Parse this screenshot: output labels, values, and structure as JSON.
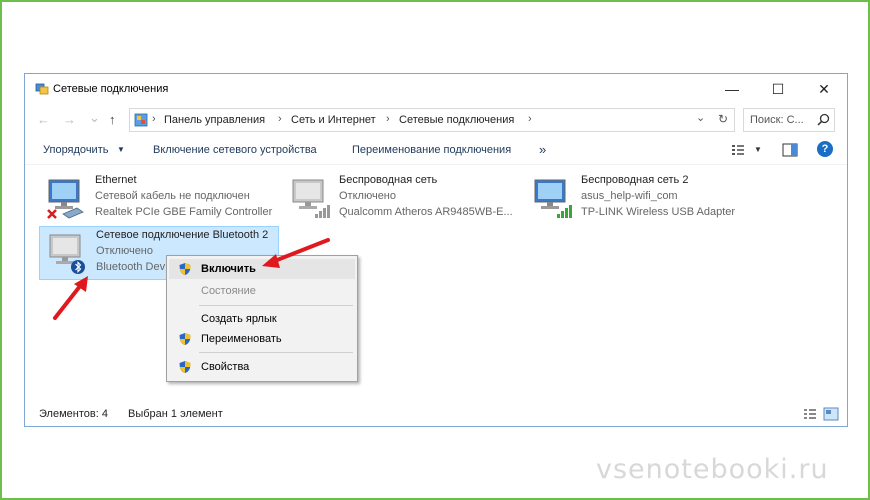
{
  "window": {
    "title": "Сетевые подключения",
    "controls": {
      "minimize": "—",
      "maximize": "☐",
      "close": "✕"
    }
  },
  "nav": {
    "back": "←",
    "forward": "→",
    "recent": "⌄",
    "up": "↑"
  },
  "address": {
    "chevron": "›",
    "crumbs": [
      "Панель управления",
      "Сеть и Интернет",
      "Сетевые подключения"
    ],
    "dropdown": "⌄",
    "refresh": "↻"
  },
  "search": {
    "placeholder": "Поиск: С..."
  },
  "toolbar": {
    "organize": "Упорядочить",
    "organize_arrow": "▼",
    "enable_device": "Включение сетевого устройства",
    "rename": "Переименование подключения",
    "more": "»",
    "view_arrow": "▼",
    "help": "?"
  },
  "connections": [
    {
      "name": "Ethernet",
      "status": "Сетевой кабель не подключен",
      "device": "Realtek PCIe GBE Family Controller"
    },
    {
      "name": "Беспроводная сеть",
      "status": "Отключено",
      "device": "Qualcomm Atheros AR9485WB-E..."
    },
    {
      "name": "Беспроводная сеть 2",
      "status": "asus_help-wifi_com",
      "device": "TP-LINK Wireless USB Adapter"
    },
    {
      "name": "Сетевое подключение Bluetooth 2",
      "status": "Отключено",
      "device": "Bluetooth Dev"
    }
  ],
  "context_menu": {
    "enable": "Включить",
    "status": "Состояние",
    "create_shortcut": "Создать ярлык",
    "rename": "Переименовать",
    "properties": "Свойства"
  },
  "statusbar": {
    "count": "Элементов: 4",
    "selected": "Выбран 1 элемент"
  },
  "watermark": "vsenotebooki.ru",
  "colors": {
    "frame": "#6cc04a",
    "arrow": "#e0191f",
    "selection": "#cce8ff",
    "help": "#1a6fc4"
  }
}
